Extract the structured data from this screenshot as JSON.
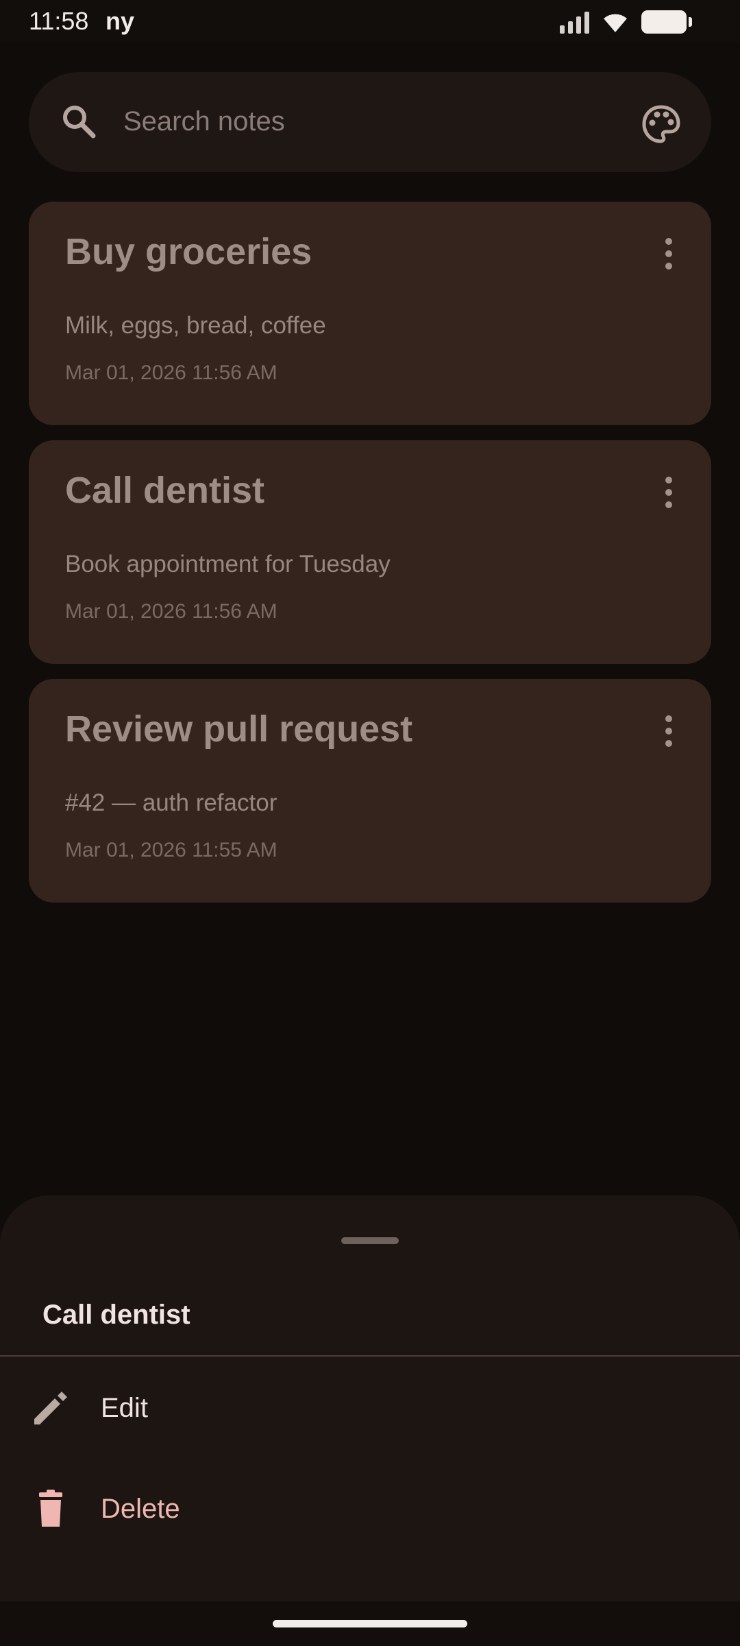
{
  "status_bar": {
    "time": "11:58",
    "carrier": "ny"
  },
  "search": {
    "placeholder": "Search notes",
    "value": ""
  },
  "notes": [
    {
      "title": "Buy groceries",
      "body": "Milk, eggs, bread, coffee",
      "date": "Mar 01, 2026 11:56 AM"
    },
    {
      "title": "Call dentist",
      "body": "Book appointment for Tuesday",
      "date": "Mar 01, 2026 11:56 AM"
    },
    {
      "title": "Review pull request",
      "body": "#42 — auth refactor",
      "date": "Mar 01, 2026 11:55 AM"
    }
  ],
  "sheet": {
    "title": "Call dentist",
    "actions": [
      {
        "label": "Edit",
        "icon": "pencil-icon"
      },
      {
        "label": "Delete",
        "icon": "trash-icon"
      }
    ]
  },
  "colors": {
    "background": "#100c0a",
    "card": "#35241e",
    "sheet": "#1d1512",
    "accent_pink": "#f0b7b2",
    "icon_muted": "#b9aaa3"
  }
}
